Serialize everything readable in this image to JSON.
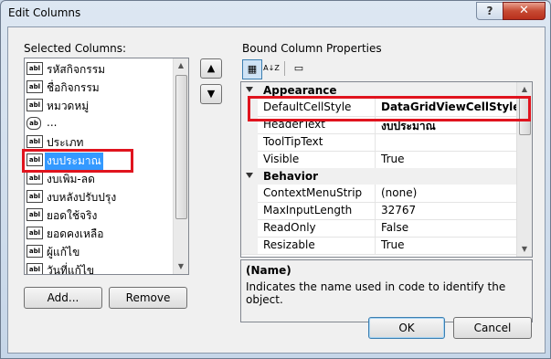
{
  "window": {
    "title": "Edit Columns",
    "help_label": "?",
    "close_label": "✕"
  },
  "left": {
    "label": "Selected Columns:",
    "items": [
      {
        "icon": "abl",
        "text": "รหัสกิจกรรม"
      },
      {
        "icon": "abl",
        "text": "ชื่อกิจกรรม"
      },
      {
        "icon": "abl",
        "text": "หมวดหมู่"
      },
      {
        "icon": "ab",
        "text": "..."
      },
      {
        "icon": "abl",
        "text": "ประเภท"
      },
      {
        "icon": "abl",
        "text": "งบประมาณ",
        "selected": true
      },
      {
        "icon": "abl",
        "text": "งบเพิ่ม-ลด"
      },
      {
        "icon": "abl",
        "text": "งบหลังปรับปรุง"
      },
      {
        "icon": "abl",
        "text": "ยอดใช้จริง"
      },
      {
        "icon": "abl",
        "text": "ยอดคงเหลือ"
      },
      {
        "icon": "abl",
        "text": "ผู้แก้ไข"
      },
      {
        "icon": "abl",
        "text": "วันที่แก้ไข"
      }
    ],
    "move_up_label": "▲",
    "move_down_label": "▼",
    "add_label": "Add...",
    "remove_label": "Remove"
  },
  "right": {
    "label": "Bound Column Properties",
    "toolbar": {
      "categorized_label": "▦",
      "alpha_label": "A↓Z",
      "pages_label": "▭"
    },
    "categories": [
      {
        "name": "Appearance",
        "rows": [
          {
            "name": "DefaultCellStyle",
            "value": "DataGridViewCellStyle { Fc"
          },
          {
            "name": "HeaderText",
            "value": "งบประมาณ"
          },
          {
            "name": "ToolTipText",
            "value": ""
          },
          {
            "name": "Visible",
            "value": "True"
          }
        ]
      },
      {
        "name": "Behavior",
        "rows": [
          {
            "name": "ContextMenuStrip",
            "value": "(none)"
          },
          {
            "name": "MaxInputLength",
            "value": "32767"
          },
          {
            "name": "ReadOnly",
            "value": "False"
          },
          {
            "name": "Resizable",
            "value": "True"
          }
        ]
      }
    ],
    "description": {
      "title": "(Name)",
      "text": "Indicates the name used in code to identify the object."
    }
  },
  "footer": {
    "ok_label": "OK",
    "cancel_label": "Cancel"
  },
  "colors": {
    "selection": "#3399ff",
    "highlight_box": "#e0141e",
    "close_button": "#c74a33"
  }
}
